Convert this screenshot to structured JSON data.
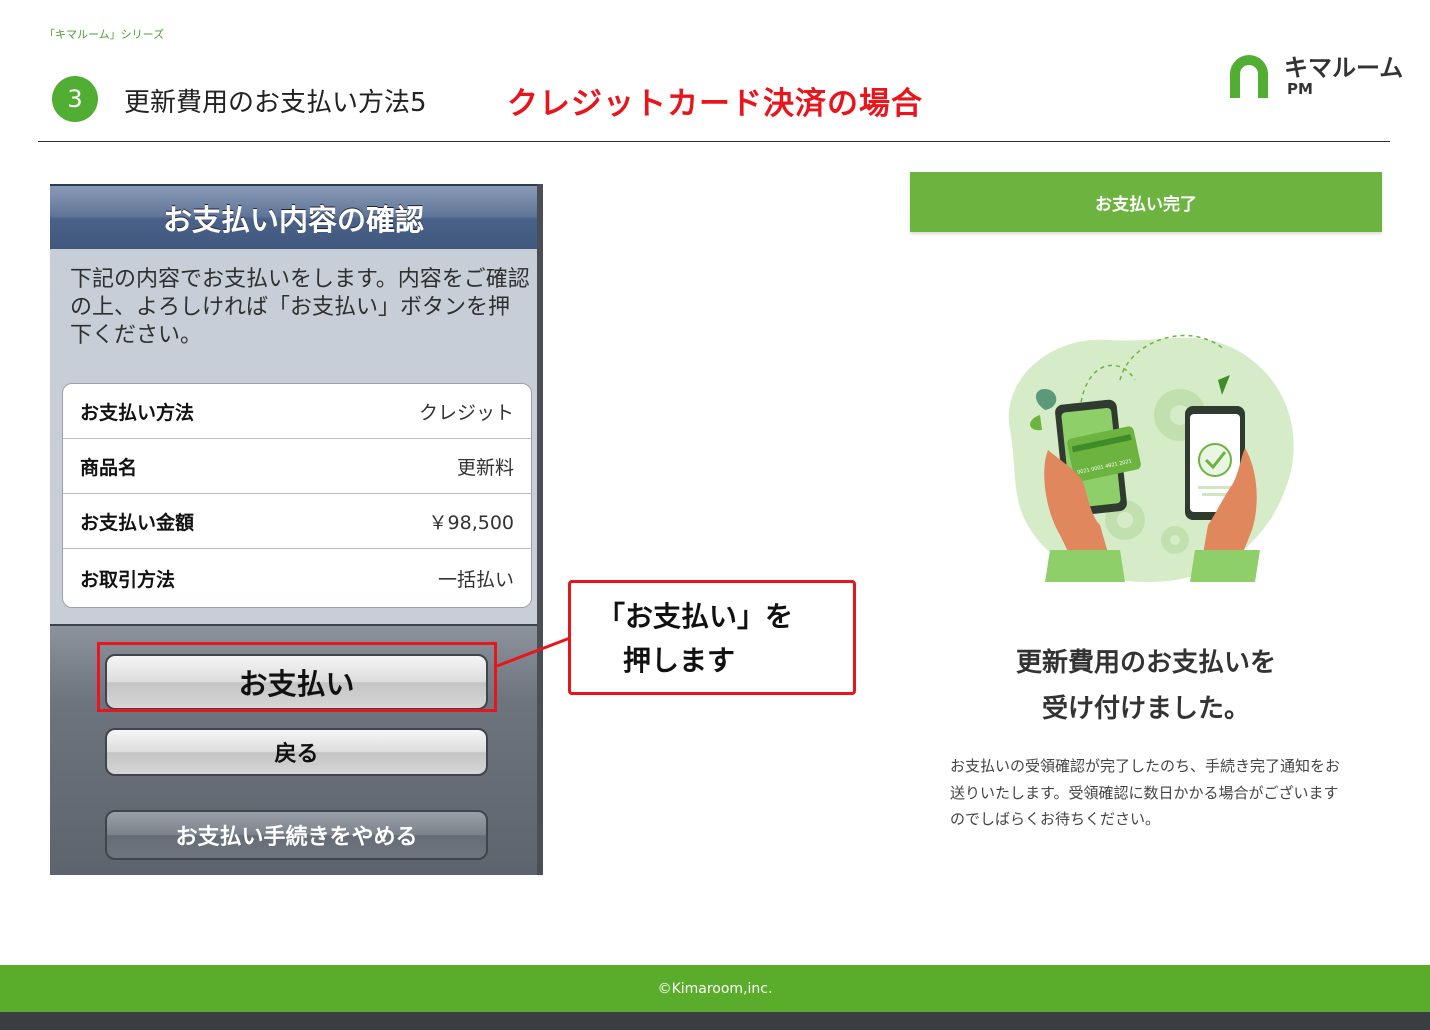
{
  "header": {
    "series": "「キマルーム」シリーズ",
    "step_number": "3",
    "title": "更新費用のお支払い方法5",
    "subtitle": "クレジットカード決済の場合",
    "logo_text": "キマルーム",
    "logo_sub": "PM"
  },
  "phone": {
    "header_title": "お支払い内容の確認",
    "description": "下記の内容でお支払いをします。内容をご確認の上、よろしければ「お支払い」ボタンを押下ください。",
    "rows": [
      {
        "label": "お支払い方法",
        "value": "クレジット"
      },
      {
        "label": "商品名",
        "value": "更新料"
      },
      {
        "label": "お支払い金額",
        "value": "￥98,500"
      },
      {
        "label": "お取引方法",
        "value": "一括払い"
      }
    ],
    "pay_button": "お支払い",
    "back_button": "戻る",
    "cancel_button": "お支払い手続きをやめる"
  },
  "callout": {
    "line1": "「お支払い」を",
    "line2": "押します"
  },
  "result": {
    "bar_label": "お支払い完了",
    "heading_line1": "更新費用のお支払いを",
    "heading_line2": "受け付けました。",
    "note": "お支払いの受領確認が完了したのち、手続き完了通知をお送りいたします。受領確認に数日かかる場合がございますのでしばらくお待ちください。",
    "card_number_text": "0021 0001 4921 2021"
  },
  "footer": {
    "copyright": "©Kimaroom,inc."
  },
  "colors": {
    "brand_green": "#52ae32",
    "accent_red": "#e8161c",
    "done_bar_green": "#6db33f"
  }
}
